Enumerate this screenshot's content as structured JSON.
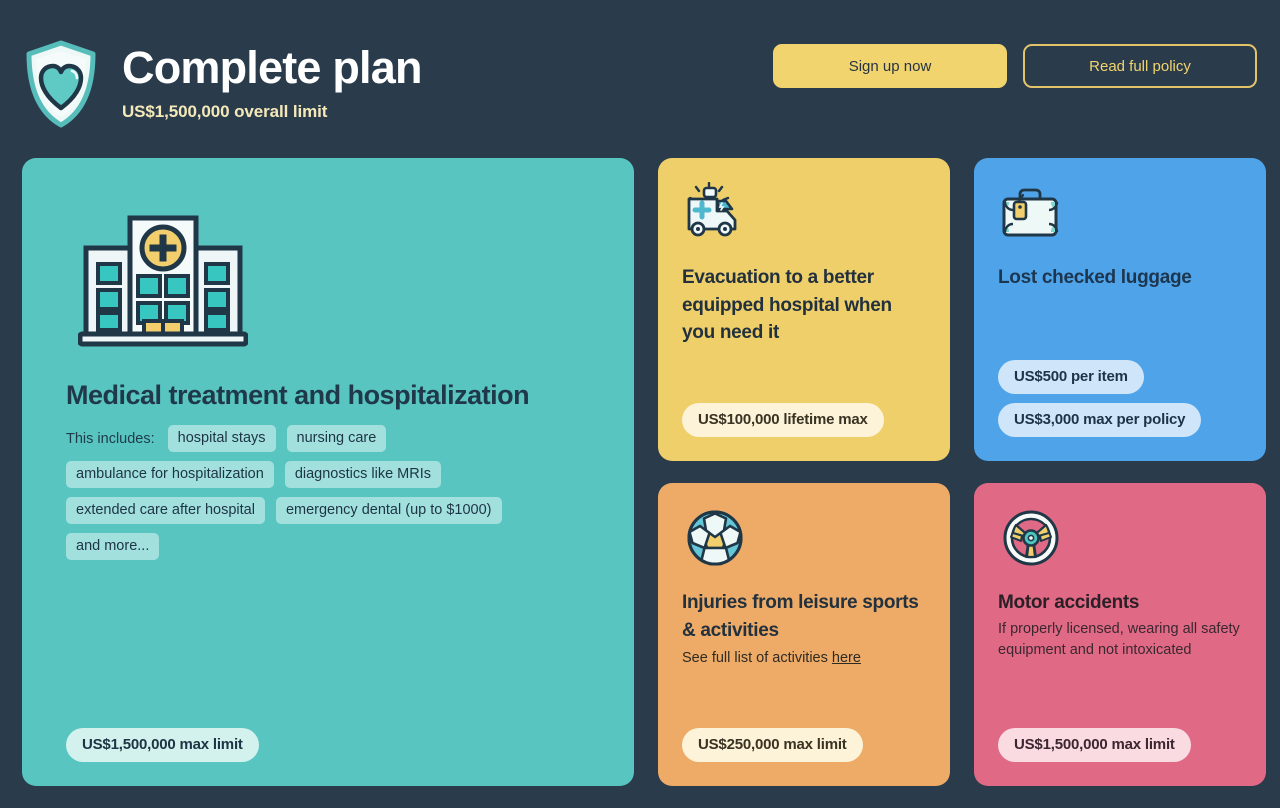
{
  "header": {
    "logo_icon": "shield-heart-icon",
    "title": "Complete plan",
    "subtitle": "US$1,500,000 overall limit",
    "buttons": {
      "primary_label": "Sign up now",
      "outline_label": "Read full policy"
    }
  },
  "colors": {
    "background": "#2a3b4c",
    "teal": "#58c5c0",
    "yellow": "#efcf69",
    "blue": "#4fa3e8",
    "orange": "#edab67",
    "pink": "#e06a85",
    "accent_yellow": "#f2d46e",
    "title_white": "#ffffff",
    "subtitle_cream": "#f5e9b9"
  },
  "cards": {
    "hero": {
      "icon": "hospital-icon",
      "title": "Medical treatment and hospitalization",
      "includes_label": "This includes:",
      "chips": [
        "hospital stays",
        "nursing care",
        "ambulance for hospitalization",
        "diagnostics like MRIs",
        "extended care after hospital",
        "emergency dental (up to $1000)",
        "and more..."
      ],
      "badge": "US$1,500,000 max limit"
    },
    "evacuation": {
      "icon": "ambulance-icon",
      "title": "Evacuation to a better equipped hospital when you need it",
      "badge": "US$100,000 lifetime max"
    },
    "luggage": {
      "icon": "suitcase-icon",
      "title": "Lost checked luggage",
      "badges": [
        "US$500 per item",
        "US$3,000 max per policy"
      ]
    },
    "sports": {
      "icon": "soccer-ball-icon",
      "title": "Injuries from leisure sports & activities",
      "subtitle_prefix": "See full list of activities ",
      "subtitle_link": "here",
      "badge": "US$250,000 max limit"
    },
    "motor": {
      "icon": "steering-wheel-icon",
      "title": "Motor accidents",
      "subtitle": "If properly licensed, wearing all safety equipment and not intoxicated",
      "badge": "US$1,500,000 max limit"
    }
  }
}
